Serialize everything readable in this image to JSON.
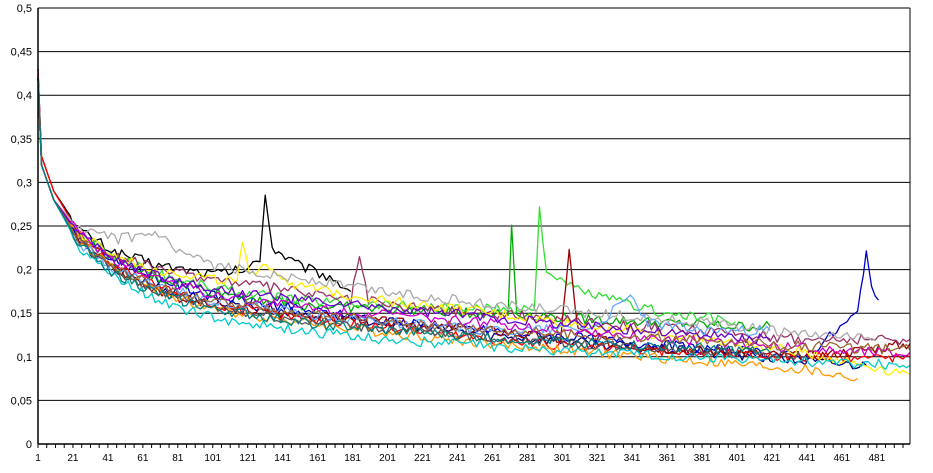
{
  "chart_data": {
    "type": "line",
    "title": "",
    "xlabel": "",
    "ylabel": "",
    "ylim": [
      0,
      0.5
    ],
    "xlim": [
      1,
      500
    ],
    "grid": true,
    "legend": "none",
    "y_ticks": [
      "0",
      "0,05",
      "0,1",
      "0,15",
      "0,2",
      "0,25",
      "0,3",
      "0,35",
      "0,4",
      "0,45",
      "0,5"
    ],
    "x_ticks": [
      "1",
      "21",
      "41",
      "61",
      "81",
      "101",
      "121",
      "141",
      "161",
      "181",
      "201",
      "221",
      "241",
      "261",
      "281",
      "301",
      "321",
      "341",
      "361",
      "381",
      "401",
      "421",
      "441",
      "461",
      "481"
    ],
    "series": [
      {
        "color": "#000000",
        "x": [
          1,
          3,
          10,
          25,
          45,
          70,
          100,
          120,
          128,
          131,
          135,
          150,
          170,
          180
        ],
        "values": [
          0.43,
          0.33,
          0.29,
          0.245,
          0.22,
          0.205,
          0.195,
          0.2,
          0.21,
          0.29,
          0.225,
          0.205,
          0.19,
          0.175
        ]
      },
      {
        "color": "#000080",
        "x": [
          1,
          3,
          10,
          25,
          45,
          70,
          100,
          150,
          200,
          260,
          320,
          380,
          440,
          475
        ],
        "values": [
          0.42,
          0.32,
          0.28,
          0.23,
          0.2,
          0.18,
          0.165,
          0.15,
          0.14,
          0.125,
          0.115,
          0.105,
          0.095,
          0.09
        ]
      },
      {
        "color": "#0000cc",
        "x": [
          1,
          3,
          10,
          25,
          45,
          70,
          100,
          150,
          200,
          260,
          320,
          380,
          440,
          470,
          475,
          478,
          482
        ],
        "values": [
          0.42,
          0.32,
          0.28,
          0.235,
          0.21,
          0.19,
          0.17,
          0.155,
          0.14,
          0.13,
          0.12,
          0.11,
          0.1,
          0.15,
          0.225,
          0.175,
          0.165
        ]
      },
      {
        "color": "#00aa00",
        "x": [
          1,
          3,
          10,
          25,
          45,
          70,
          100,
          150,
          200,
          250,
          270,
          272,
          275,
          300,
          350,
          400,
          420
        ],
        "values": [
          0.42,
          0.32,
          0.28,
          0.24,
          0.21,
          0.19,
          0.175,
          0.16,
          0.155,
          0.15,
          0.15,
          0.25,
          0.15,
          0.145,
          0.14,
          0.135,
          0.135
        ]
      },
      {
        "color": "#33dd33",
        "x": [
          1,
          3,
          10,
          25,
          45,
          70,
          100,
          150,
          200,
          250,
          285,
          288,
          292,
          300,
          320,
          360,
          400
        ],
        "values": [
          0.42,
          0.32,
          0.28,
          0.24,
          0.215,
          0.195,
          0.18,
          0.165,
          0.16,
          0.155,
          0.155,
          0.27,
          0.2,
          0.185,
          0.17,
          0.15,
          0.14
        ]
      },
      {
        "color": "#ff0000",
        "x": [
          1,
          3,
          10,
          25,
          45,
          70,
          100,
          150,
          200,
          260,
          320,
          380,
          440,
          500
        ],
        "values": [
          0.43,
          0.33,
          0.29,
          0.24,
          0.205,
          0.18,
          0.16,
          0.145,
          0.135,
          0.12,
          0.11,
          0.105,
          0.1,
          0.1
        ]
      },
      {
        "color": "#990000",
        "x": [
          1,
          3,
          10,
          25,
          45,
          70,
          100,
          150,
          200,
          260,
          300,
          305,
          310,
          330,
          360,
          400,
          440,
          500
        ],
        "values": [
          0.42,
          0.32,
          0.28,
          0.235,
          0.2,
          0.175,
          0.158,
          0.148,
          0.14,
          0.13,
          0.12,
          0.22,
          0.13,
          0.115,
          0.11,
          0.105,
          0.1,
          0.115
        ]
      },
      {
        "color": "#993366",
        "x": [
          1,
          3,
          10,
          25,
          45,
          70,
          100,
          150,
          180,
          185,
          190,
          200,
          260,
          320,
          380,
          440,
          500
        ],
        "values": [
          0.42,
          0.32,
          0.28,
          0.24,
          0.215,
          0.2,
          0.19,
          0.175,
          0.165,
          0.215,
          0.165,
          0.16,
          0.15,
          0.14,
          0.13,
          0.12,
          0.12
        ]
      },
      {
        "color": "#ff9900",
        "x": [
          1,
          3,
          10,
          25,
          45,
          70,
          100,
          150,
          200,
          260,
          320,
          380,
          440,
          470
        ],
        "values": [
          0.42,
          0.32,
          0.28,
          0.235,
          0.2,
          0.175,
          0.155,
          0.14,
          0.128,
          0.115,
          0.105,
          0.095,
          0.085,
          0.075
        ]
      },
      {
        "color": "#ffee00",
        "x": [
          1,
          3,
          10,
          25,
          45,
          70,
          100,
          115,
          118,
          122,
          130,
          135,
          150,
          200,
          260,
          320,
          380,
          440,
          500
        ],
        "values": [
          0.42,
          0.32,
          0.28,
          0.24,
          0.215,
          0.2,
          0.19,
          0.185,
          0.23,
          0.19,
          0.21,
          0.2,
          0.18,
          0.165,
          0.15,
          0.135,
          0.12,
          0.105,
          0.08
        ]
      },
      {
        "color": "#aaaaaa",
        "x": [
          1,
          3,
          10,
          25,
          45,
          70,
          80,
          100,
          150,
          200,
          260,
          320,
          380,
          440,
          480
        ],
        "values": [
          0.42,
          0.32,
          0.28,
          0.245,
          0.235,
          0.24,
          0.22,
          0.205,
          0.19,
          0.175,
          0.16,
          0.15,
          0.14,
          0.125,
          0.12
        ]
      },
      {
        "color": "#00cccc",
        "x": [
          1,
          3,
          10,
          25,
          45,
          70,
          100,
          150,
          200,
          260,
          320,
          380,
          440,
          500
        ],
        "values": [
          0.42,
          0.32,
          0.28,
          0.225,
          0.19,
          0.165,
          0.145,
          0.13,
          0.12,
          0.112,
          0.105,
          0.1,
          0.095,
          0.09
        ]
      },
      {
        "color": "#66aaff",
        "x": [
          1,
          3,
          10,
          25,
          45,
          70,
          100,
          150,
          200,
          260,
          320,
          340,
          350,
          360,
          380,
          420
        ],
        "values": [
          0.42,
          0.32,
          0.28,
          0.23,
          0.2,
          0.18,
          0.165,
          0.15,
          0.14,
          0.13,
          0.135,
          0.17,
          0.14,
          0.135,
          0.13,
          0.13
        ]
      },
      {
        "color": "#cc00cc",
        "x": [
          1,
          3,
          10,
          25,
          45,
          70,
          100,
          150,
          200,
          260,
          320,
          380,
          440,
          500
        ],
        "values": [
          0.42,
          0.32,
          0.28,
          0.24,
          0.21,
          0.19,
          0.172,
          0.158,
          0.148,
          0.138,
          0.128,
          0.118,
          0.11,
          0.105
        ]
      },
      {
        "color": "#6600cc",
        "x": [
          1,
          3,
          10,
          25,
          45,
          70,
          100,
          150,
          200,
          260,
          320,
          380,
          420
        ],
        "values": [
          0.42,
          0.32,
          0.28,
          0.238,
          0.212,
          0.192,
          0.178,
          0.165,
          0.155,
          0.145,
          0.135,
          0.125,
          0.12
        ]
      },
      {
        "color": "#555555",
        "x": [
          1,
          3,
          10,
          25,
          45,
          70,
          100,
          150,
          200,
          260,
          320,
          380,
          440
        ],
        "values": [
          0.42,
          0.32,
          0.28,
          0.23,
          0.198,
          0.175,
          0.158,
          0.142,
          0.132,
          0.122,
          0.114,
          0.108,
          0.1
        ]
      },
      {
        "color": "#996633",
        "x": [
          1,
          3,
          10,
          25,
          45,
          70,
          100,
          150,
          200,
          260,
          320,
          380,
          440,
          500
        ],
        "values": [
          0.42,
          0.32,
          0.28,
          0.232,
          0.202,
          0.18,
          0.163,
          0.15,
          0.14,
          0.132,
          0.124,
          0.118,
          0.112,
          0.108
        ]
      },
      {
        "color": "#008080",
        "x": [
          1,
          3,
          10,
          25,
          45,
          70,
          100,
          150,
          200,
          260,
          320,
          380,
          420
        ],
        "values": [
          0.42,
          0.32,
          0.28,
          0.228,
          0.195,
          0.172,
          0.155,
          0.14,
          0.13,
          0.122,
          0.115,
          0.11,
          0.105
        ]
      }
    ]
  }
}
